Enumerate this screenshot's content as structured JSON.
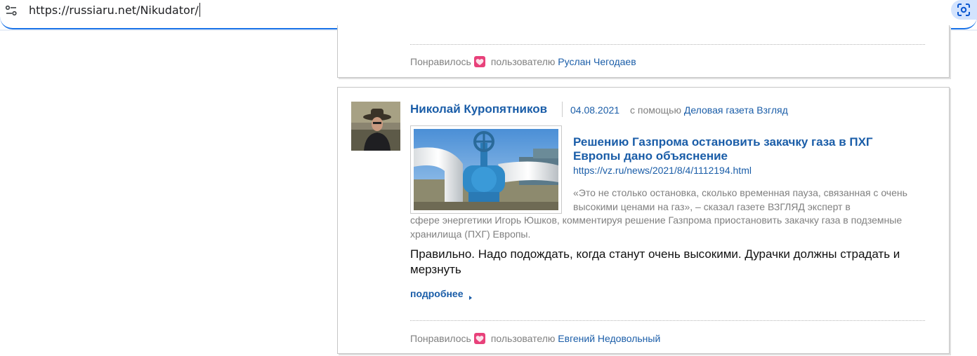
{
  "browser": {
    "url": "https://russiaru.net/Nikudator/",
    "icons": {
      "site_settings": "tune-icon",
      "lens": "google-lens-icon"
    },
    "accent_color": "#1a73e8"
  },
  "feed": {
    "top_card": {
      "liked_label": "Понравилось",
      "liked_by_prefix": "пользователю",
      "liked_by_user": "Руслан Чегодаев"
    },
    "post": {
      "author": "Николай Куропятников",
      "date": "04.08.2021",
      "via_label": "с помощью",
      "via_source": "Деловая газета Взгляд",
      "article": {
        "title": "Решению Газпрома остановить закачку газа в ПХГ Европы дано объяснение",
        "url": "https://vz.ru/news/2021/8/4/1112194.html",
        "excerpt_part1": "«Это не столько остановка, сколько временная пауза, связанная с очень высокими ценами на газ», – сказал газете ВЗГЛЯД эксперт в",
        "excerpt_part2": "сфере энергетики Игорь Юшков, комментируя решение Газпрома приостановить закачку газа в подземные хранилища (ПХГ) Европы."
      },
      "text": "Правильно. Надо подождать, когда станут очень высокими. Дурачки должны страдать и мерзнуть",
      "more_label": "подробнее",
      "liked_label": "Понравилось",
      "liked_by_prefix": "пользователю",
      "liked_by_user": "Евгений Недовольный"
    },
    "colors": {
      "link": "#1a5da8",
      "muted": "#808080",
      "heart": "#e8417a"
    }
  }
}
